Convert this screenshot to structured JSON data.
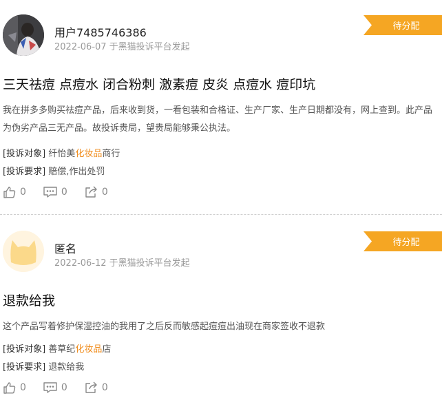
{
  "posts": [
    {
      "user": "用户7485746386",
      "meta": "2022-06-07 于黑猫投诉平台发起",
      "status": "待分配",
      "title": "三天祛痘 点痘水 闭合粉刺 激素痘 皮炎 点痘水 痘印坑",
      "description": "我在拼多多购买祛痘产品，后来收到货，一看包装和合格证、生产厂家、生产日期都没有，网上查到。此产品为伪劣产品三无产品。故投诉贵局，望贵局能够秉公执法。",
      "target_label": "[投诉对象]",
      "target_pre": "纤怡美",
      "target_hl": "化妆品",
      "target_post": "商行",
      "request_label": "[投诉要求]",
      "request": "赔偿,作出处罚",
      "likes": "0",
      "comments": "0",
      "shares": "0"
    },
    {
      "user": "匿名",
      "meta": "2022-06-12 于黑猫投诉平台发起",
      "status": "待分配",
      "title": "退款给我",
      "description": "这个产品写着修护保湿控油的我用了之后反而敏感起痘痘出油现在商家签收不退款",
      "target_label": "[投诉对象]",
      "target_pre": "善草纪",
      "target_hl": "化妆品",
      "target_post": "店",
      "request_label": "[投诉要求]",
      "request": "退款给我",
      "likes": "0",
      "comments": "0",
      "shares": "0"
    }
  ],
  "colors": {
    "accent": "#f5a623",
    "highlight": "#f08c1c",
    "muted": "#999999"
  },
  "icons": [
    "thumbs-up-icon",
    "comment-icon",
    "share-icon",
    "cat-avatar-icon"
  ]
}
